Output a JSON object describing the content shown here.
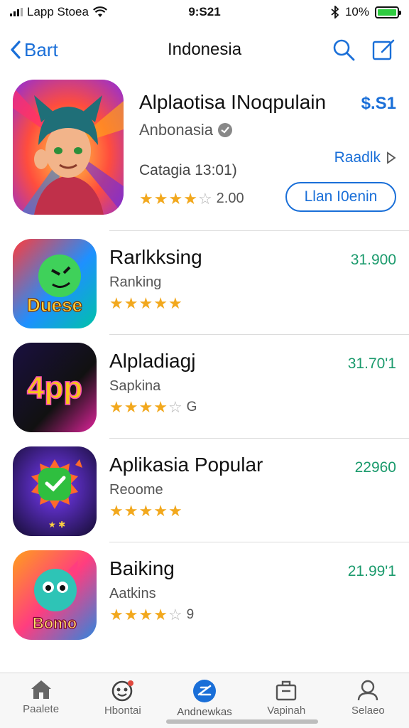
{
  "status_bar": {
    "carrier": "Lapp Stoea",
    "time": "9:S21",
    "battery_percent": "10%",
    "battery_level": 1.0,
    "battery_color": "#2ecc40"
  },
  "nav": {
    "back_label": "Bart",
    "title": "Indonesia",
    "search_icon": "search-icon",
    "compose_icon": "compose-icon"
  },
  "featured": {
    "title": "Alplaotisa INoqpulain",
    "price": "$.S1",
    "developer": "Anbonasia",
    "link_label": "Raadlk",
    "category": "Catagia 13:01)",
    "rating": 3.5,
    "rating_count": "2.00",
    "button_label": "Llan I0enin"
  },
  "apps": [
    {
      "title": "Rarlkksing",
      "subtitle": "Ranking",
      "rating": 4.5,
      "extra": "",
      "price": "31.900",
      "icon_text": "Duese"
    },
    {
      "title": "Alpladiagj",
      "subtitle": "Sapkina",
      "rating": 4,
      "extra": "G",
      "price": "31.70'1",
      "icon_text": "4pp"
    },
    {
      "title": "Aplikasia Popular",
      "subtitle": "Reoome",
      "rating": 4.5,
      "extra": "",
      "price": "22960",
      "icon_text": ""
    },
    {
      "title": "Baiking",
      "subtitle": "Aatkins",
      "rating": 3.5,
      "extra": "9",
      "price": "21.99'1",
      "icon_text": "Bomo"
    }
  ],
  "tabs": [
    {
      "label": "Paalete",
      "icon": "home-icon"
    },
    {
      "label": "Hbontai",
      "icon": "games-face-icon"
    },
    {
      "label": "Andnewkas",
      "icon": "apps-icon"
    },
    {
      "label": "Vapinah",
      "icon": "bag-icon"
    },
    {
      "label": "Selaeo",
      "icon": "person-icon"
    }
  ],
  "colors": {
    "accent": "#1a6fd8",
    "price_green": "#1a9a6c",
    "star": "#f2a81d"
  }
}
